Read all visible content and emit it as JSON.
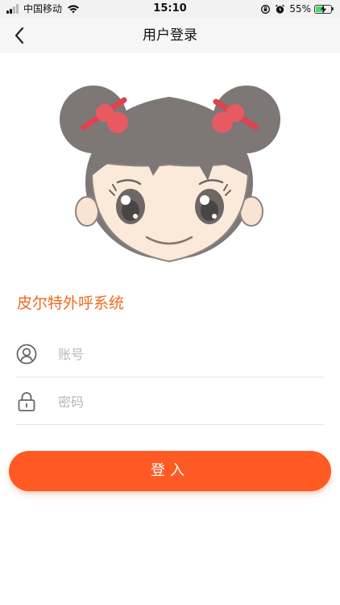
{
  "status_bar": {
    "carrier": "中国移动",
    "time": "15:10",
    "battery_percent": "55%",
    "battery_level": 0.55,
    "battery_color": "#4cd964"
  },
  "nav": {
    "back_icon": "chevron-left-icon",
    "title": "用户登录"
  },
  "avatar": {
    "icon": "cartoon-girl-avatar"
  },
  "app_name": "皮尔特外呼系统",
  "form": {
    "account": {
      "icon": "user-circle-icon",
      "placeholder": "账号",
      "value": ""
    },
    "password": {
      "icon": "lock-icon",
      "placeholder": "密码",
      "value": ""
    }
  },
  "login_button": {
    "label": "登入",
    "color": "#ff5a23"
  },
  "colors": {
    "accent": "#f06a1e",
    "nav_bg": "#f6f6f6"
  }
}
